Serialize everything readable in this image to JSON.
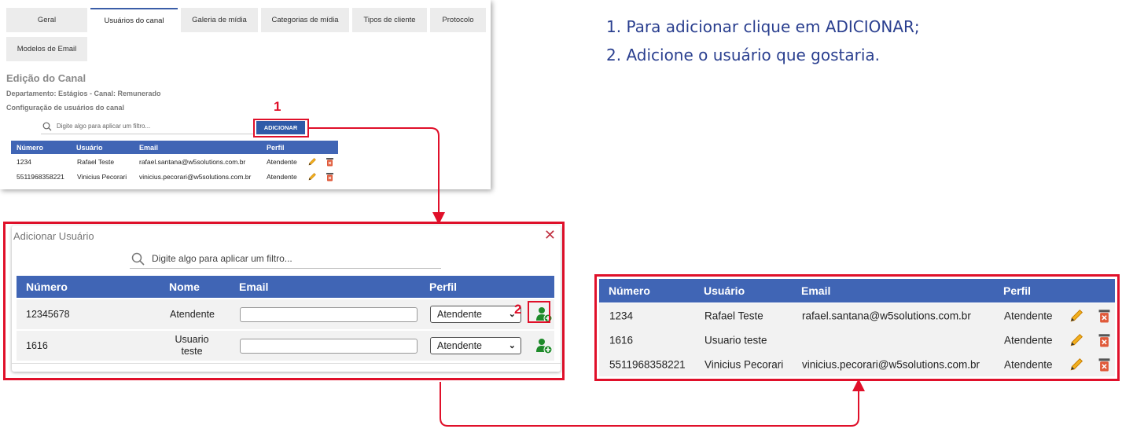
{
  "channel_editor": {
    "tabs": [
      "Geral",
      "Usuários do canal",
      "Galeria de mídia",
      "Categorias de mídia",
      "Tipos de cliente",
      "Protocolo",
      "Modelos de Email"
    ],
    "active_tab": "Usuários do canal",
    "title": "Edição do Canal",
    "department": "Departamento: Estágios - Canal: Remunerado",
    "section": "Configuração de usuários do canal",
    "search_placeholder": "Digite algo para aplicar um filtro...",
    "add_button": "ADICIONAR",
    "columns": [
      "Número",
      "Usuário",
      "Email",
      "Perfil"
    ],
    "rows": [
      {
        "numero": "1234",
        "usuario": "Rafael Teste",
        "email": "rafael.santana@w5solutions.com.br",
        "perfil": "Atendente"
      },
      {
        "numero": "5511968358221",
        "usuario": "Vinicius Pecorari",
        "email": "vinicius.pecorari@w5solutions.com.br",
        "perfil": "Atendente"
      }
    ]
  },
  "step_labels": {
    "one": "1",
    "two": "2"
  },
  "add_user_modal": {
    "title": "Adicionar Usuário",
    "close": "✕",
    "search_placeholder": "Digite algo para aplicar um filtro...",
    "columns": [
      "Número",
      "Nome",
      "Email",
      "Perfil"
    ],
    "rows": [
      {
        "numero": "12345678",
        "nome": "Atendente",
        "email": "",
        "perfil": "Atendente"
      },
      {
        "numero": "1616",
        "nome": "Usuario teste",
        "email": "",
        "perfil": "Atendente"
      }
    ]
  },
  "instructions": [
    "1. Para adicionar clique em ADICIONAR;",
    "2. Adicione o usuário que gostaria."
  ],
  "result_table": {
    "columns": [
      "Número",
      "Usuário",
      "Email",
      "Perfil"
    ],
    "rows": [
      {
        "numero": "1234",
        "usuario": "Rafael Teste",
        "email": "rafael.santana@w5solutions.com.br",
        "perfil": "Atendente"
      },
      {
        "numero": "1616",
        "usuario": "Usuario teste",
        "email": "",
        "perfil": "Atendente"
      },
      {
        "numero": "5511968358221",
        "usuario": "Vinicius Pecorari",
        "email": "vinicius.pecorari@w5solutions.com.br",
        "perfil": "Atendente"
      }
    ]
  },
  "colors": {
    "accent_blue": "#4065b5",
    "annotation_red": "#e0102a",
    "instruction_text": "#2a3f8f"
  }
}
